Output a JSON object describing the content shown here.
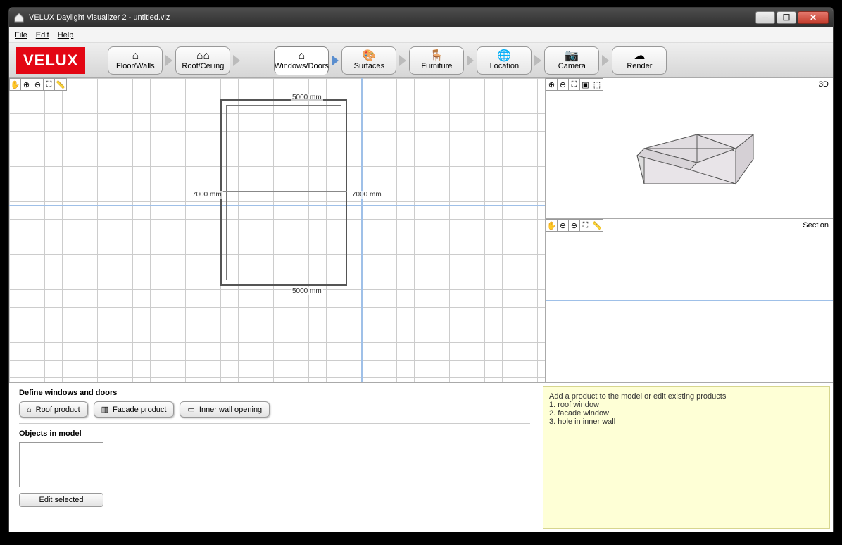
{
  "window": {
    "title": "VELUX Daylight Visualizer 2 - untitled.viz"
  },
  "menubar": {
    "file": "File",
    "edit": "Edit",
    "help": "Help"
  },
  "logo": "VELUX",
  "steps": {
    "floor": "Floor/Walls",
    "roof": "Roof/Ceiling",
    "windows": "Windows/Doors",
    "surfaces": "Surfaces",
    "furniture": "Furniture",
    "location": "Location",
    "camera": "Camera",
    "render": "Render"
  },
  "canvas": {
    "dim_top": "5000 mm",
    "dim_bottom": "5000 mm",
    "dim_left": "7000 mm",
    "dim_right": "7000 mm"
  },
  "panels": {
    "three_d": "3D",
    "section": "Section"
  },
  "define": {
    "title": "Define windows and doors",
    "roof_btn": "Roof product",
    "facade_btn": "Facade product",
    "inner_btn": "Inner wall opening",
    "objects_label": "Objects in model",
    "edit_btn": "Edit selected"
  },
  "help": {
    "line0": "Add a product to the model or edit existing products",
    "line1": "1. roof window",
    "line2": "2. facade window",
    "line3": "3. hole in inner wall"
  }
}
